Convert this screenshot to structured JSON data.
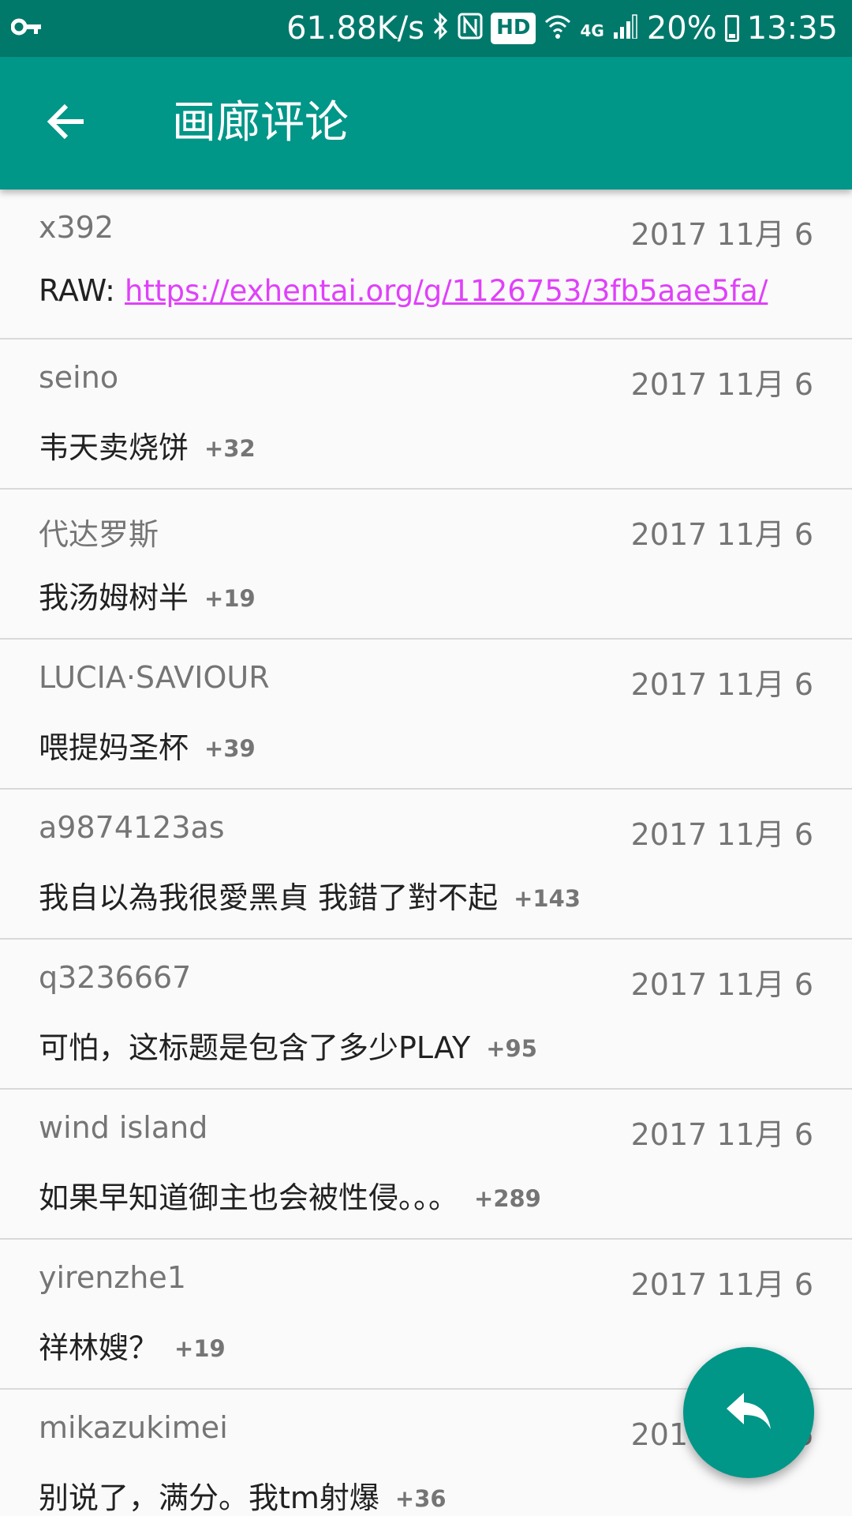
{
  "status_bar": {
    "net_speed": "61.88K/s",
    "hd": "HD",
    "network": "4G",
    "battery": "20%",
    "time": "13:35"
  },
  "toolbar": {
    "title": "画廊评论"
  },
  "comments": [
    {
      "user": "x392",
      "date": "2017 11月 6",
      "prefix": "RAW: ",
      "link": "https://exhentai.org/g/1126753/3fb5aae5fa/"
    },
    {
      "user": "seino",
      "date": "2017 11月 6",
      "text": "韦天卖烧饼",
      "score": "+32"
    },
    {
      "user": "代达罗斯",
      "date": "2017 11月 6",
      "text": "我汤姆树半",
      "score": "+19"
    },
    {
      "user": "LUCIA·SAVIOUR",
      "date": "2017 11月 6",
      "text": "喂提妈圣杯",
      "score": "+39"
    },
    {
      "user": "a9874123as",
      "date": "2017 11月 6",
      "text": "我自以為我很愛黑貞 我錯了對不起",
      "score": "+143"
    },
    {
      "user": "q3236667",
      "date": "2017 11月 6",
      "text": "可怕，这标题是包含了多少PLAY",
      "score": "+95"
    },
    {
      "user": "wind island",
      "date": "2017 11月 6",
      "text": "如果早知道御主也会被性侵。。。",
      "score": "+289"
    },
    {
      "user": "yirenzhe1",
      "date": "2017 11月 6",
      "text": "祥林嫂？",
      "score": "+19"
    },
    {
      "user": "mikazukimei",
      "date": "2017 11月 6",
      "text": "别说了，满分。我tm射爆",
      "score": "+36"
    }
  ],
  "fab": {
    "icon": "reply-icon"
  },
  "colors": {
    "status_bar": "#00796b",
    "toolbar": "#009688",
    "link": "#e040fb",
    "secondary_text": "#757575",
    "primary_text": "#212121"
  }
}
